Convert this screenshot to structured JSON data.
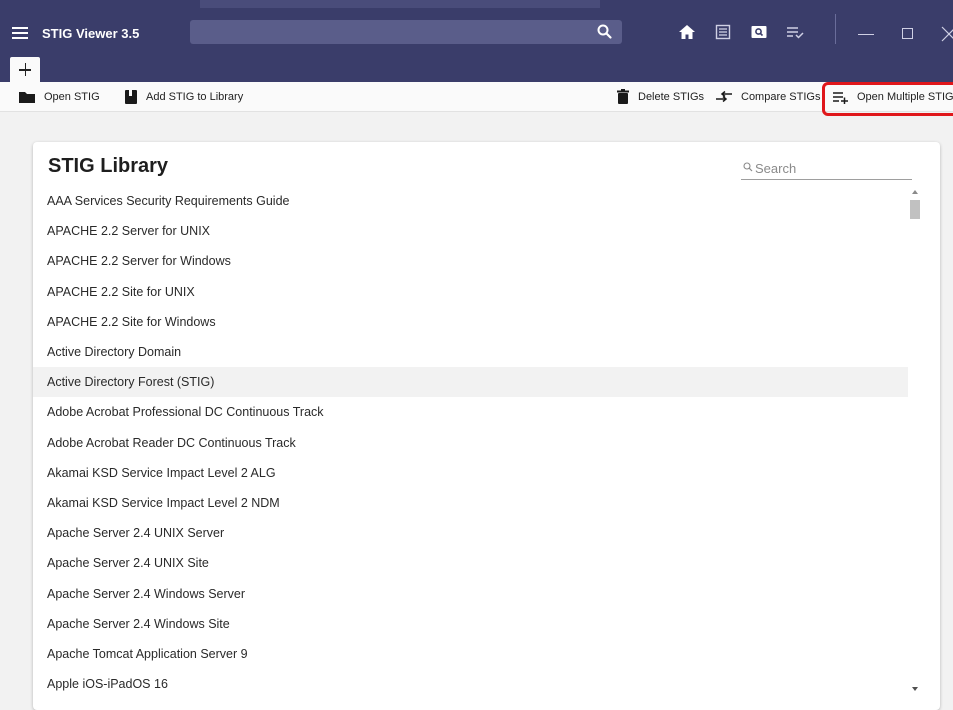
{
  "app": {
    "title": "STIG Viewer 3.5"
  },
  "toolbar": {
    "open_stig": "Open STIG",
    "add_stig": "Add STIG to Library",
    "delete_stigs": "Delete STIGs",
    "compare_stigs": "Compare STIGs",
    "open_multiple": "Open Multiple STIG"
  },
  "library": {
    "title": "STIG Library",
    "search_placeholder": "Search",
    "items": [
      "AAA Services Security Requirements Guide",
      "APACHE 2.2 Server for UNIX",
      "APACHE 2.2 Server for Windows",
      "APACHE 2.2 Site for UNIX",
      "APACHE 2.2 Site for Windows",
      "Active Directory Domain",
      "Active Directory Forest (STIG)",
      "Adobe Acrobat Professional DC Continuous Track",
      "Adobe Acrobat Reader DC Continuous Track",
      "Akamai KSD Service Impact Level 2 ALG",
      "Akamai KSD Service Impact Level 2 NDM",
      "Apache Server 2.4 UNIX Server",
      "Apache Server 2.4 UNIX Site",
      "Apache Server 2.4 Windows Server",
      "Apache Server 2.4 Windows Site",
      "Apache Tomcat Application Server 9",
      "Apple iOS-iPadOS 16"
    ],
    "selected_index": 6
  },
  "colors": {
    "titlebar": "#3a3d6a",
    "highlight": "#e0171b",
    "selected_row": "#f2f2f2"
  },
  "icons": [
    "menu-icon",
    "search-icon",
    "home-icon",
    "list-icon",
    "preview-icon",
    "playlist-check-icon",
    "minimize-icon",
    "maximize-icon",
    "close-icon",
    "add-tab-icon",
    "folder-icon",
    "book-icon",
    "trash-icon",
    "compare-arrows-icon",
    "playlist-add-icon"
  ]
}
